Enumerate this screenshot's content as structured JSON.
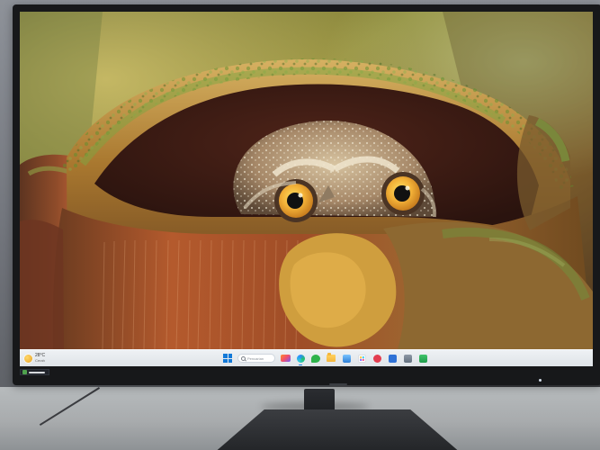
{
  "taskbar": {
    "weather": {
      "temperature": "28°C",
      "condition": "Cerah",
      "icon": "sun-icon"
    },
    "search": {
      "placeholder": "Pencarian",
      "icon": "search-icon"
    },
    "apps": [
      {
        "name": "start",
        "icon": "windows-start-icon"
      },
      {
        "name": "search",
        "icon": "search-icon"
      },
      {
        "name": "thumbnail",
        "icon": "widget-thumbnail-icon"
      },
      {
        "name": "edge",
        "icon": "edge-browser-icon"
      },
      {
        "name": "chat",
        "icon": "chat-icon"
      },
      {
        "name": "folder",
        "icon": "file-explorer-icon"
      },
      {
        "name": "store",
        "icon": "microsoft-store-icon"
      },
      {
        "name": "photos",
        "icon": "photos-icon"
      },
      {
        "name": "red-app",
        "icon": "red-app-icon"
      },
      {
        "name": "blue-app",
        "icon": "blue-app-icon"
      },
      {
        "name": "grey-app",
        "icon": "grey-app-icon"
      },
      {
        "name": "green-app",
        "icon": "green-app-icon"
      }
    ]
  }
}
